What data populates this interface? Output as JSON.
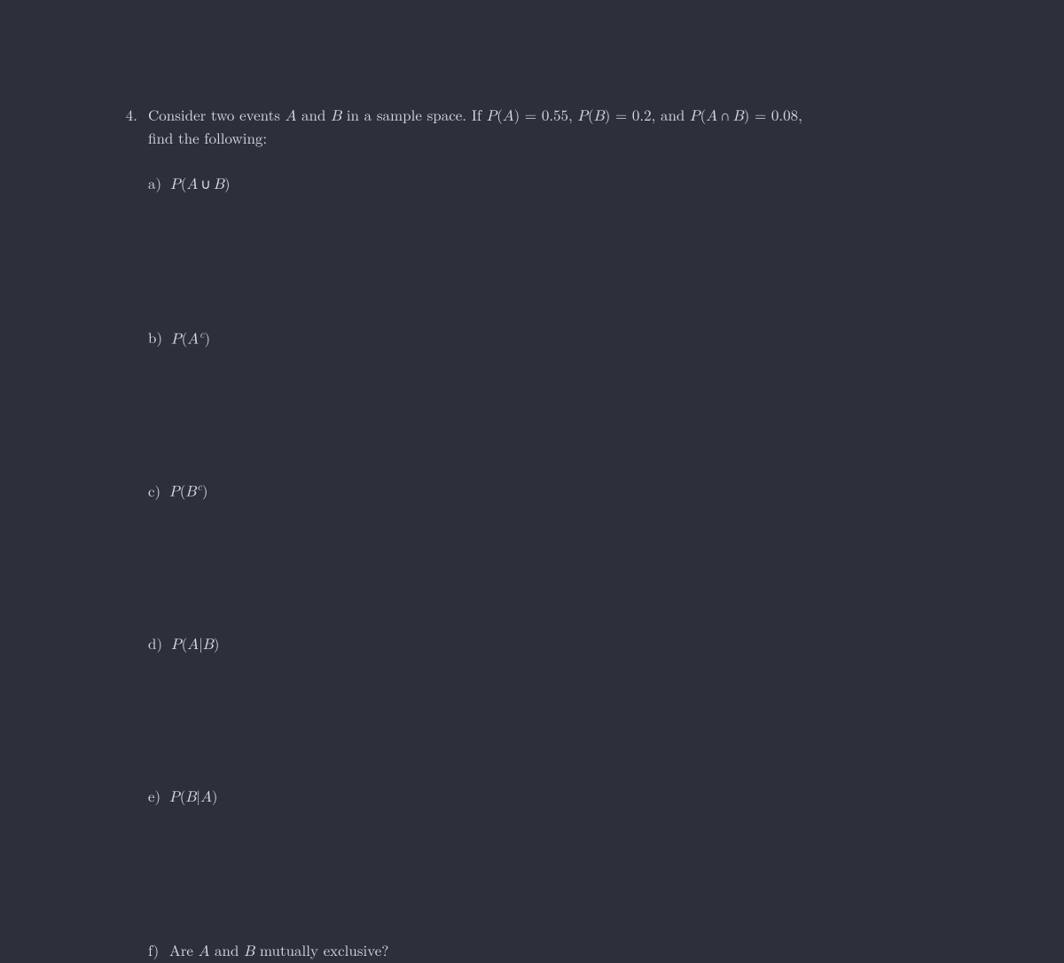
{
  "problem": {
    "number": "4.",
    "text_pre": "Consider two events ",
    "A": "A",
    "text_and": " and ",
    "B": "B",
    "text_mid": " in a sample space.  If ",
    "PA_lbl": "P",
    "PA_open": "(",
    "PA_var": "A",
    "PA_close": ") = 0.55",
    "sep1": ",  ",
    "PB_lbl": "P",
    "PB_open": "(",
    "PB_var": "B",
    "PB_close": ") = 0.2",
    "sep2": ", and ",
    "PAB_lbl": "P",
    "PAB_open": "(",
    "PAB_A": "A",
    "PAB_cap": "∩",
    "PAB_B": "B",
    "PAB_close": ") = 0.08",
    "sep3": ",",
    "text_post": "find the following:"
  },
  "items": {
    "a": {
      "label": "a)",
      "P": "P",
      "open": "(",
      "A": "A",
      "cup": "∪",
      "B": "B",
      "close": ")"
    },
    "b": {
      "label": "b)",
      "P": "P",
      "open": "(",
      "A": "A",
      "sup": "c",
      "close": ")"
    },
    "c": {
      "label": "c)",
      "P": "P",
      "open": "(",
      "B": "B",
      "sup": "c",
      "close": ")"
    },
    "d": {
      "label": "d)",
      "P": "P",
      "open": "(",
      "A": "A",
      "bar": "|",
      "B": "B",
      "close": ")"
    },
    "e": {
      "label": "e)",
      "P": "P",
      "open": "(",
      "B": "B",
      "bar": "|",
      "A": "A",
      "close": ")"
    },
    "f": {
      "label": "f)",
      "pre": "Are ",
      "A": "A",
      "and": " and ",
      "B": "B",
      "post": " mutually exclusive?"
    }
  }
}
